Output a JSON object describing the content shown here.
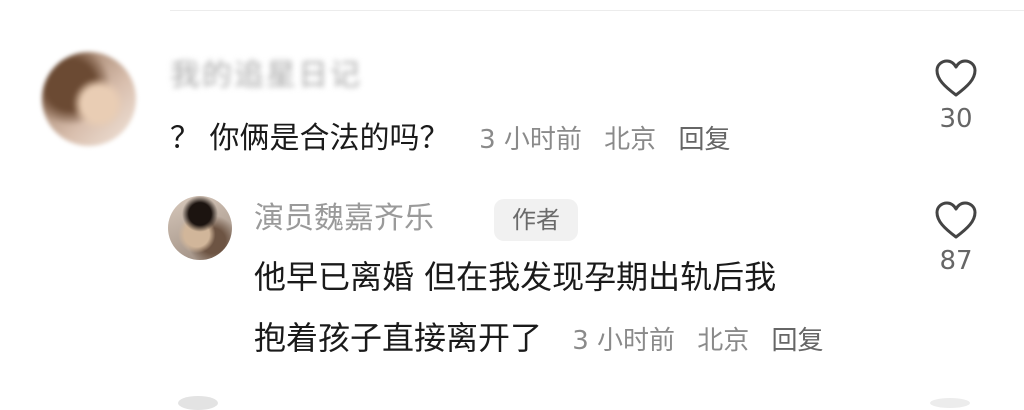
{
  "comment": {
    "username": "我的追星日记",
    "text": "？ 你俩是合法的吗？",
    "time": "3 小时前",
    "location": "北京",
    "reply_label": "回复",
    "likes": "30"
  },
  "reply": {
    "username": "演员魏嘉齐乐",
    "badge": "作者",
    "text_line1": "他早已离婚  但在我发现孕期出轨后我",
    "text_line2": "抱着孩子直接离开了",
    "time": "3 小时前",
    "location": "北京",
    "reply_label": "回复",
    "likes": "87"
  },
  "icons": {
    "like": "heart-outline-icon"
  },
  "colors": {
    "text_primary": "#1a1a1a",
    "text_secondary": "#8a8a8a",
    "badge_bg": "#f1f1f1"
  }
}
